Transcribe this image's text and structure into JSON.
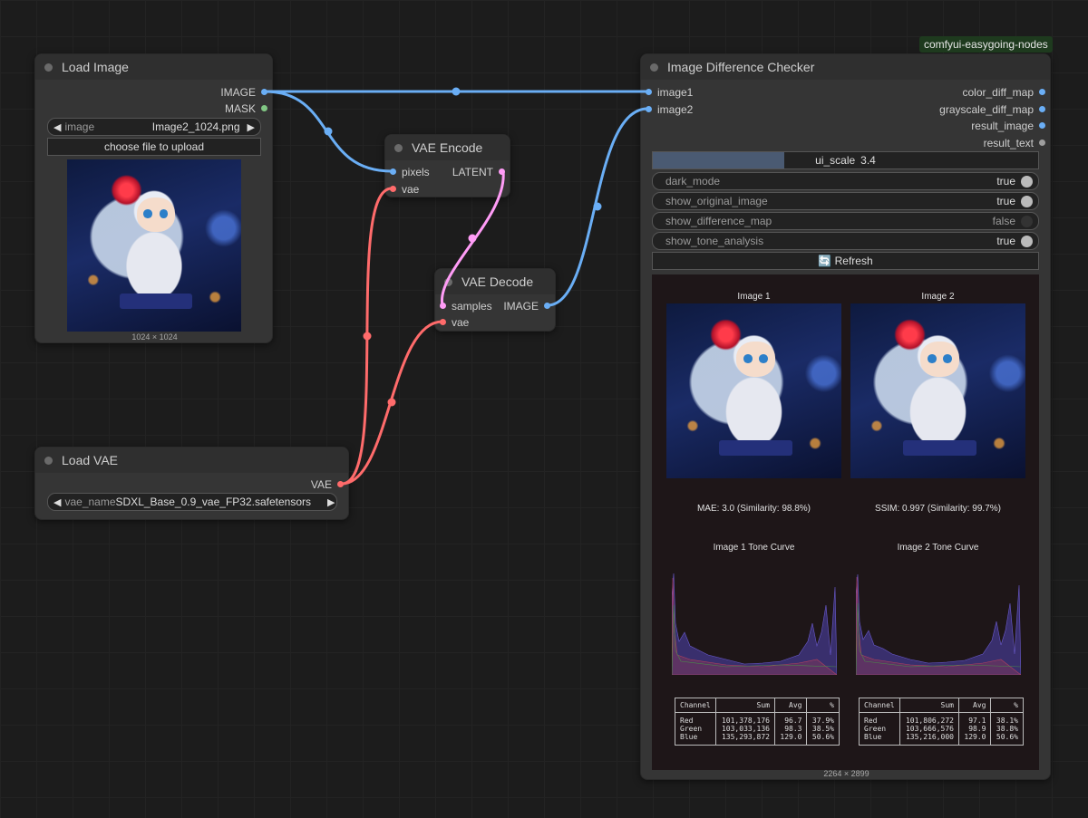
{
  "badge": "comfyui-easygoing-nodes",
  "colors": {
    "image": "#6aaef5",
    "vae": "#ff6b6b",
    "latent": "#ff9cf6",
    "mask": "#81c784",
    "text": "#9e9e9e"
  },
  "load_image": {
    "title": "Load Image",
    "outputs": [
      "IMAGE",
      "MASK"
    ],
    "image_widget": {
      "label": "image",
      "value": "Image2_1024.png"
    },
    "upload_button": "choose file to upload",
    "dimensions": "1024 × 1024"
  },
  "vae_encode": {
    "title": "VAE Encode",
    "inputs": [
      "pixels",
      "vae"
    ],
    "output": "LATENT"
  },
  "vae_decode": {
    "title": "VAE Decode",
    "inputs": [
      "samples",
      "vae"
    ],
    "output": "IMAGE"
  },
  "load_vae": {
    "title": "Load VAE",
    "output": "VAE",
    "widget": {
      "label": "vae_name",
      "value": "SDXL_Base_0.9_vae_FP32.safetensors"
    }
  },
  "checker": {
    "title": "Image Difference Checker",
    "inputs": [
      "image1",
      "image2"
    ],
    "outputs": [
      "color_diff_map",
      "grayscale_diff_map",
      "result_image",
      "result_text"
    ],
    "ui_scale": {
      "label": "ui_scale",
      "value": "3.4",
      "fraction": 0.34
    },
    "toggles": [
      {
        "label": "dark_mode",
        "value": "true"
      },
      {
        "label": "show_original_image",
        "value": "true"
      },
      {
        "label": "show_difference_map",
        "value": "false"
      },
      {
        "label": "show_tone_analysis",
        "value": "true"
      }
    ],
    "refresh_icon": "refresh-icon",
    "refresh": "🔄 Refresh",
    "preview": {
      "image1_title": "Image 1",
      "image2_title": "Image 2",
      "mae": "MAE: 3.0 (Similarity: 98.8%)",
      "ssim": "SSIM: 0.997 (Similarity: 99.7%)",
      "curve1_title": "Image 1 Tone Curve",
      "curve2_title": "Image 2 Tone Curve",
      "table_headers": [
        "Channel",
        "Sum",
        "Avg",
        "%"
      ],
      "table1": [
        [
          "Red",
          "101,378,176",
          "96.7",
          "37.9%"
        ],
        [
          "Green",
          "103,033,136",
          "98.3",
          "38.5%"
        ],
        [
          "Blue",
          "135,293,872",
          "129.0",
          "50.6%"
        ]
      ],
      "table2": [
        [
          "Red",
          "101,806,272",
          "97.1",
          "38.1%"
        ],
        [
          "Green",
          "103,666,576",
          "98.9",
          "38.8%"
        ],
        [
          "Blue",
          "135,216,000",
          "129.0",
          "50.6%"
        ]
      ]
    },
    "dimensions": "2264 × 2899"
  }
}
